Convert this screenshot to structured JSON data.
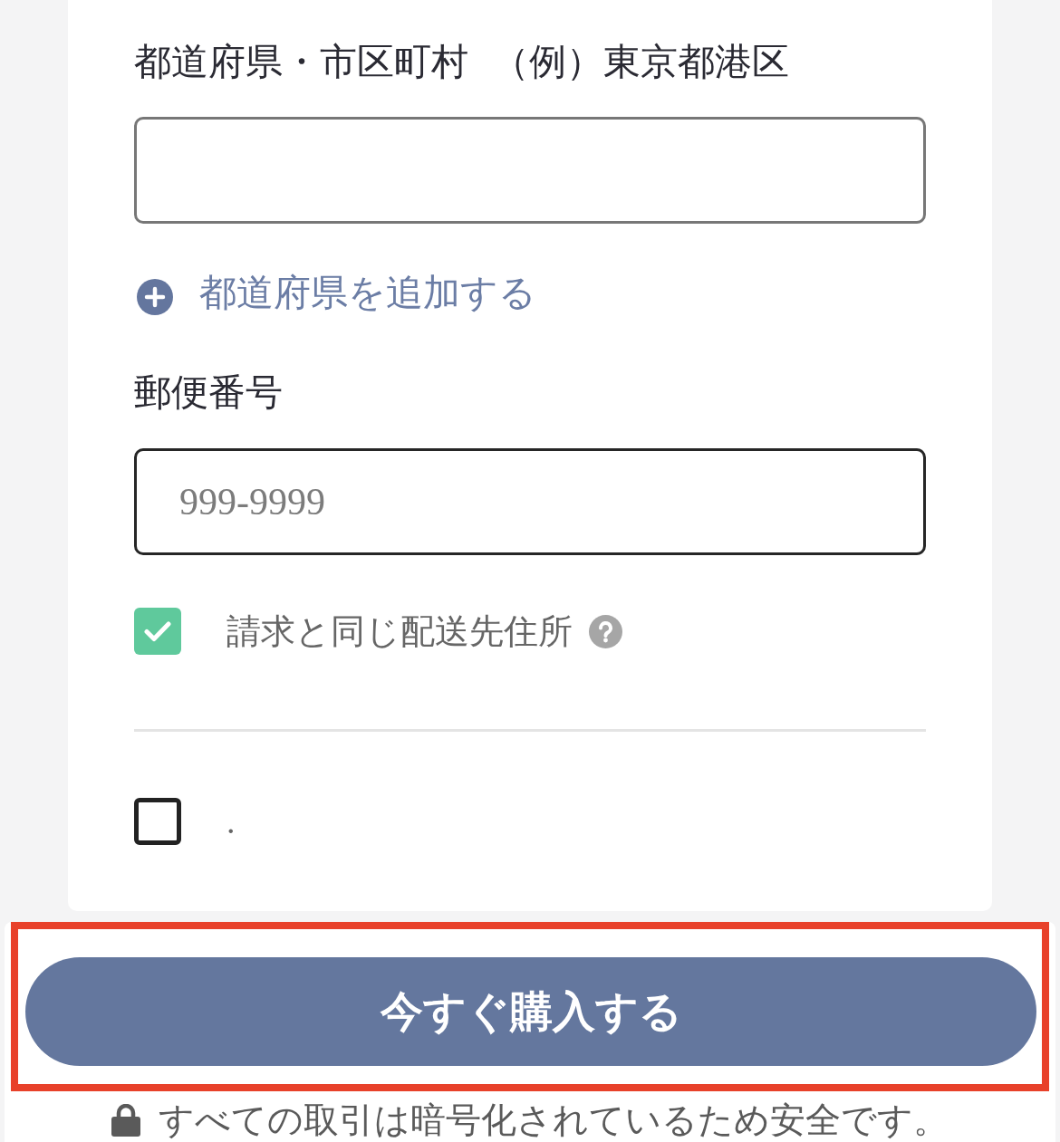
{
  "address_field": {
    "label": "都道府県・市区町村",
    "example": "（例）東京都港区"
  },
  "add_prefecture_link": {
    "label": "都道府県を追加する"
  },
  "postal_code_field": {
    "label": "郵便番号",
    "placeholder": "999-9999"
  },
  "checkboxes": [
    {
      "label": "請求と同じ配送先住所",
      "checked": true,
      "help": true
    },
    {
      "label": ".",
      "checked": false,
      "help": false
    }
  ],
  "purchase_button": {
    "label": "今すぐ購入する",
    "highlighted": true
  },
  "security_note": {
    "text": "すべての取引は暗号化されているため安全です。"
  }
}
